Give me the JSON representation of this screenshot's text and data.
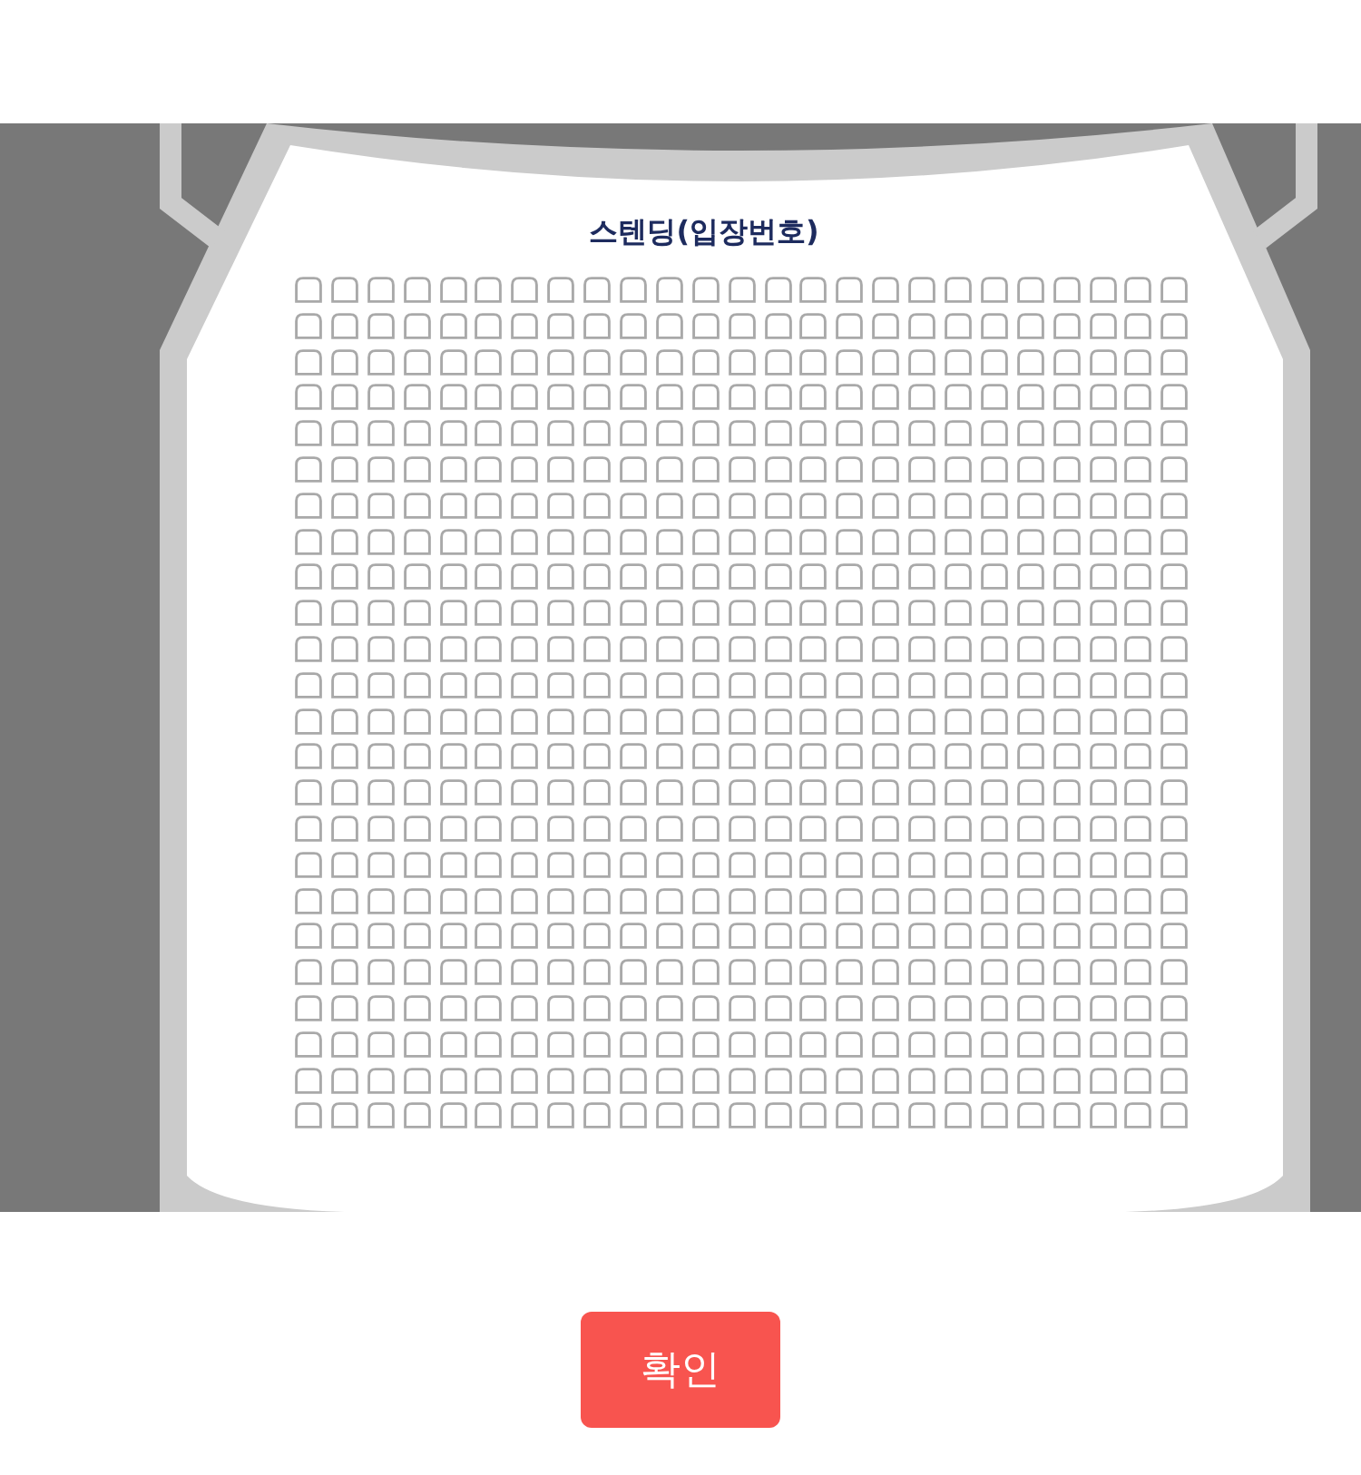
{
  "seat_map": {
    "title": "스텐딩(입장번호)",
    "rows": [
      {
        "seats": [
          {
            "selected": false
          },
          {
            "selected": false
          },
          {
            "selected": false
          },
          {
            "selected": false
          },
          {
            "selected": false
          },
          {
            "selected": false
          },
          {
            "selected": false
          },
          {
            "selected": false
          },
          {
            "selected": false
          },
          {
            "selected": false
          },
          {
            "selected": false
          },
          {
            "selected": false
          },
          {
            "selected": false
          },
          {
            "selected": false
          },
          {
            "selected": false
          },
          {
            "selected": false
          },
          {
            "selected": false
          },
          {
            "selected": false
          },
          {
            "selected": false
          },
          {
            "selected": false
          },
          {
            "selected": false
          },
          {
            "selected": false
          },
          {
            "selected": false
          },
          {
            "selected": false
          },
          {
            "selected": false
          }
        ]
      },
      {
        "seats": [
          {
            "selected": false
          },
          {
            "selected": false
          },
          {
            "selected": false
          },
          {
            "selected": false
          },
          {
            "selected": false
          },
          {
            "selected": false
          },
          {
            "selected": false
          },
          {
            "selected": false
          },
          {
            "selected": false
          },
          {
            "selected": false
          },
          {
            "selected": false
          },
          {
            "selected": false
          },
          {
            "selected": false
          },
          {
            "selected": false
          },
          {
            "selected": false
          },
          {
            "selected": false
          },
          {
            "selected": false
          },
          {
            "selected": false
          },
          {
            "selected": false
          },
          {
            "selected": false
          },
          {
            "selected": false
          },
          {
            "selected": false
          },
          {
            "selected": false
          },
          {
            "selected": false
          },
          {
            "selected": false
          }
        ]
      },
      {
        "seats": [
          {
            "selected": false
          },
          {
            "selected": false
          },
          {
            "selected": false
          },
          {
            "selected": false
          },
          {
            "selected": false
          },
          {
            "selected": false
          },
          {
            "selected": false
          },
          {
            "selected": false
          },
          {
            "selected": false
          },
          {
            "selected": false
          },
          {
            "selected": false
          },
          {
            "selected": false
          },
          {
            "selected": false
          },
          {
            "selected": false
          },
          {
            "selected": false
          },
          {
            "selected": false
          },
          {
            "selected": false
          },
          {
            "selected": false
          },
          {
            "selected": false
          },
          {
            "selected": false
          },
          {
            "selected": false
          },
          {
            "selected": false
          },
          {
            "selected": false
          },
          {
            "selected": false
          },
          {
            "selected": false
          }
        ]
      },
      {
        "seats": [
          {
            "selected": false
          },
          {
            "selected": false
          },
          {
            "selected": false
          },
          {
            "selected": false
          },
          {
            "selected": false
          },
          {
            "selected": false
          },
          {
            "selected": false
          },
          {
            "selected": false
          },
          {
            "selected": false
          },
          {
            "selected": false
          },
          {
            "selected": false
          },
          {
            "selected": false
          },
          {
            "selected": false
          },
          {
            "selected": false
          },
          {
            "selected": false
          },
          {
            "selected": false
          },
          {
            "selected": false
          },
          {
            "selected": false
          },
          {
            "selected": false
          },
          {
            "selected": false
          },
          {
            "selected": false
          },
          {
            "selected": false
          },
          {
            "selected": false
          },
          {
            "selected": false
          },
          {
            "selected": false
          }
        ]
      },
      {
        "seats": [
          {
            "selected": false
          },
          {
            "selected": false
          },
          {
            "selected": false
          },
          {
            "selected": false
          },
          {
            "selected": false
          },
          {
            "selected": false
          },
          {
            "selected": false
          },
          {
            "selected": false
          },
          {
            "selected": false
          },
          {
            "selected": false
          },
          {
            "selected": false
          },
          {
            "selected": false
          },
          {
            "selected": false
          },
          {
            "selected": false
          },
          {
            "selected": false
          },
          {
            "selected": false
          },
          {
            "selected": false
          },
          {
            "selected": false
          },
          {
            "selected": false
          },
          {
            "selected": false
          },
          {
            "selected": false
          },
          {
            "selected": false
          },
          {
            "selected": false
          },
          {
            "selected": false
          },
          {
            "selected": false
          }
        ]
      },
      {
        "seats": [
          {
            "selected": false
          },
          {
            "selected": false
          },
          {
            "selected": false
          },
          {
            "selected": false
          },
          {
            "selected": false
          },
          {
            "selected": false
          },
          {
            "selected": false
          },
          {
            "selected": false
          },
          {
            "selected": false
          },
          {
            "selected": false
          },
          {
            "selected": false
          },
          {
            "selected": false
          },
          {
            "selected": false
          },
          {
            "selected": false
          },
          {
            "selected": false
          },
          {
            "selected": false
          },
          {
            "selected": false
          },
          {
            "selected": false
          },
          {
            "selected": false
          },
          {
            "selected": false
          },
          {
            "selected": false
          },
          {
            "selected": false
          },
          {
            "selected": false
          },
          {
            "selected": false
          },
          {
            "selected": false
          }
        ]
      },
      {
        "seats": [
          {
            "selected": false
          },
          {
            "selected": false
          },
          {
            "selected": false
          },
          {
            "selected": false
          },
          {
            "selected": false
          },
          {
            "selected": false
          },
          {
            "selected": false
          },
          {
            "selected": false
          },
          {
            "selected": false
          },
          {
            "selected": false
          },
          {
            "selected": false
          },
          {
            "selected": false
          },
          {
            "selected": false
          },
          {
            "selected": false
          },
          {
            "selected": false
          },
          {
            "selected": false
          },
          {
            "selected": false
          },
          {
            "selected": false
          },
          {
            "selected": false
          },
          {
            "selected": false
          },
          {
            "selected": false
          },
          {
            "selected": false
          },
          {
            "selected": false
          },
          {
            "selected": false
          },
          {
            "selected": false
          }
        ]
      },
      {
        "seats": [
          {
            "selected": false
          },
          {
            "selected": false
          },
          {
            "selected": false
          },
          {
            "selected": false
          },
          {
            "selected": false
          },
          {
            "selected": false
          },
          {
            "selected": false
          },
          {
            "selected": false
          },
          {
            "selected": false
          },
          {
            "selected": false
          },
          {
            "selected": false
          },
          {
            "selected": false
          },
          {
            "selected": false
          },
          {
            "selected": false
          },
          {
            "selected": false
          },
          {
            "selected": false
          },
          {
            "selected": false
          },
          {
            "selected": false
          },
          {
            "selected": false
          },
          {
            "selected": false
          },
          {
            "selected": false
          },
          {
            "selected": false
          },
          {
            "selected": false
          },
          {
            "selected": false
          },
          {
            "selected": false
          }
        ]
      },
      {
        "seats": [
          {
            "selected": false
          },
          {
            "selected": false
          },
          {
            "selected": false
          },
          {
            "selected": false
          },
          {
            "selected": false
          },
          {
            "selected": false
          },
          {
            "selected": false
          },
          {
            "selected": false
          },
          {
            "selected": false
          },
          {
            "selected": false
          },
          {
            "selected": false
          },
          {
            "selected": false
          },
          {
            "selected": false
          },
          {
            "selected": false
          },
          {
            "selected": false
          },
          {
            "selected": false
          },
          {
            "selected": false
          },
          {
            "selected": false
          },
          {
            "selected": false
          },
          {
            "selected": false
          },
          {
            "selected": false
          },
          {
            "selected": false
          },
          {
            "selected": false
          },
          {
            "selected": false
          },
          {
            "selected": false
          }
        ]
      },
      {
        "seats": [
          {
            "selected": false
          },
          {
            "selected": false
          },
          {
            "selected": false
          },
          {
            "selected": false
          },
          {
            "selected": false
          },
          {
            "selected": false
          },
          {
            "selected": false
          },
          {
            "selected": false
          },
          {
            "selected": false
          },
          {
            "selected": false
          },
          {
            "selected": false
          },
          {
            "selected": false
          },
          {
            "selected": false
          },
          {
            "selected": false
          },
          {
            "selected": false
          },
          {
            "selected": false
          },
          {
            "selected": false
          },
          {
            "selected": false
          },
          {
            "selected": false
          },
          {
            "selected": false
          },
          {
            "selected": false
          },
          {
            "selected": false
          },
          {
            "selected": false
          },
          {
            "selected": false
          },
          {
            "selected": false
          }
        ]
      },
      {
        "seats": [
          {
            "selected": false
          },
          {
            "selected": false
          },
          {
            "selected": false
          },
          {
            "selected": false
          },
          {
            "selected": false
          },
          {
            "selected": false
          },
          {
            "selected": false
          },
          {
            "selected": false
          },
          {
            "selected": false
          },
          {
            "selected": false
          },
          {
            "selected": false
          },
          {
            "selected": false
          },
          {
            "selected": false
          },
          {
            "selected": false
          },
          {
            "selected": false
          },
          {
            "selected": false
          },
          {
            "selected": false
          },
          {
            "selected": false
          },
          {
            "selected": false
          },
          {
            "selected": false
          },
          {
            "selected": false
          },
          {
            "selected": false
          },
          {
            "selected": false
          },
          {
            "selected": false
          },
          {
            "selected": false
          }
        ]
      },
      {
        "seats": [
          {
            "selected": false
          },
          {
            "selected": false
          },
          {
            "selected": false
          },
          {
            "selected": false
          },
          {
            "selected": false
          },
          {
            "selected": false
          },
          {
            "selected": false
          },
          {
            "selected": false
          },
          {
            "selected": false
          },
          {
            "selected": false
          },
          {
            "selected": false
          },
          {
            "selected": false
          },
          {
            "selected": false
          },
          {
            "selected": false
          },
          {
            "selected": false
          },
          {
            "selected": false
          },
          {
            "selected": false
          },
          {
            "selected": false
          },
          {
            "selected": false
          },
          {
            "selected": false
          },
          {
            "selected": false
          },
          {
            "selected": false
          },
          {
            "selected": false
          },
          {
            "selected": false
          },
          {
            "selected": false
          }
        ]
      },
      {
        "seats": [
          {
            "selected": false
          },
          {
            "selected": false
          },
          {
            "selected": false
          },
          {
            "selected": false
          },
          {
            "selected": false
          },
          {
            "selected": false
          },
          {
            "selected": false
          },
          {
            "selected": false
          },
          {
            "selected": false
          },
          {
            "selected": false
          },
          {
            "selected": false
          },
          {
            "selected": false
          },
          {
            "selected": false
          },
          {
            "selected": false
          },
          {
            "selected": false
          },
          {
            "selected": false
          },
          {
            "selected": false
          },
          {
            "selected": false
          },
          {
            "selected": false
          },
          {
            "selected": false
          },
          {
            "selected": false
          },
          {
            "selected": false
          },
          {
            "selected": false
          },
          {
            "selected": false
          },
          {
            "selected": false
          }
        ]
      },
      {
        "seats": [
          {
            "selected": false
          },
          {
            "selected": false
          },
          {
            "selected": false
          },
          {
            "selected": false
          },
          {
            "selected": false
          },
          {
            "selected": false
          },
          {
            "selected": false
          },
          {
            "selected": false
          },
          {
            "selected": false
          },
          {
            "selected": false
          },
          {
            "selected": false
          },
          {
            "selected": false
          },
          {
            "selected": false
          },
          {
            "selected": false
          },
          {
            "selected": false
          },
          {
            "selected": false
          },
          {
            "selected": false
          },
          {
            "selected": false
          },
          {
            "selected": false
          },
          {
            "selected": false
          },
          {
            "selected": false
          },
          {
            "selected": false
          },
          {
            "selected": false
          },
          {
            "selected": false
          },
          {
            "selected": false
          }
        ]
      },
      {
        "seats": [
          {
            "selected": false
          },
          {
            "selected": false
          },
          {
            "selected": false
          },
          {
            "selected": false
          },
          {
            "selected": false
          },
          {
            "selected": false
          },
          {
            "selected": false
          },
          {
            "selected": false
          },
          {
            "selected": false
          },
          {
            "selected": false
          },
          {
            "selected": false
          },
          {
            "selected": false
          },
          {
            "selected": false
          },
          {
            "selected": false
          },
          {
            "selected": false
          },
          {
            "selected": false
          },
          {
            "selected": false
          },
          {
            "selected": false
          },
          {
            "selected": false
          },
          {
            "selected": false
          },
          {
            "selected": false
          },
          {
            "selected": false
          },
          {
            "selected": false
          },
          {
            "selected": false
          },
          {
            "selected": false
          }
        ]
      },
      {
        "seats": [
          {
            "selected": false
          },
          {
            "selected": false
          },
          {
            "selected": false
          },
          {
            "selected": false
          },
          {
            "selected": false
          },
          {
            "selected": false
          },
          {
            "selected": false
          },
          {
            "selected": false
          },
          {
            "selected": false
          },
          {
            "selected": false
          },
          {
            "selected": false
          },
          {
            "selected": false
          },
          {
            "selected": false
          },
          {
            "selected": false
          },
          {
            "selected": false
          },
          {
            "selected": false
          },
          {
            "selected": false
          },
          {
            "selected": false
          },
          {
            "selected": false
          },
          {
            "selected": false
          },
          {
            "selected": false
          },
          {
            "selected": false
          },
          {
            "selected": false
          },
          {
            "selected": false
          },
          {
            "selected": false
          }
        ]
      },
      {
        "seats": [
          {
            "selected": false
          },
          {
            "selected": false
          },
          {
            "selected": false
          },
          {
            "selected": false
          },
          {
            "selected": false
          },
          {
            "selected": false
          },
          {
            "selected": false
          },
          {
            "selected": false
          },
          {
            "selected": false
          },
          {
            "selected": false
          },
          {
            "selected": false
          },
          {
            "selected": false
          },
          {
            "selected": false
          },
          {
            "selected": false
          },
          {
            "selected": false
          },
          {
            "selected": false
          },
          {
            "selected": false
          },
          {
            "selected": false
          },
          {
            "selected": false
          },
          {
            "selected": false
          },
          {
            "selected": false
          },
          {
            "selected": false
          },
          {
            "selected": false
          },
          {
            "selected": false
          },
          {
            "selected": false
          }
        ]
      },
      {
        "seats": [
          {
            "selected": false
          },
          {
            "selected": false
          },
          {
            "selected": false
          },
          {
            "selected": false
          },
          {
            "selected": false
          },
          {
            "selected": false
          },
          {
            "selected": false
          },
          {
            "selected": false
          },
          {
            "selected": false
          },
          {
            "selected": false
          },
          {
            "selected": false
          },
          {
            "selected": false
          },
          {
            "selected": false
          },
          {
            "selected": false
          },
          {
            "selected": false
          },
          {
            "selected": false
          },
          {
            "selected": false
          },
          {
            "selected": false
          },
          {
            "selected": false
          },
          {
            "selected": false
          },
          {
            "selected": false
          },
          {
            "selected": false
          },
          {
            "selected": false
          },
          {
            "selected": false
          },
          {
            "selected": false
          }
        ]
      },
      {
        "seats": [
          {
            "selected": false
          },
          {
            "selected": false
          },
          {
            "selected": false
          },
          {
            "selected": false
          },
          {
            "selected": false
          },
          {
            "selected": false
          },
          {
            "selected": false
          },
          {
            "selected": false
          },
          {
            "selected": false
          },
          {
            "selected": false
          },
          {
            "selected": false
          },
          {
            "selected": false
          },
          {
            "selected": false
          },
          {
            "selected": false
          },
          {
            "selected": false
          },
          {
            "selected": false
          },
          {
            "selected": false
          },
          {
            "selected": false
          },
          {
            "selected": false
          },
          {
            "selected": false
          },
          {
            "selected": false
          },
          {
            "selected": false
          },
          {
            "selected": false
          },
          {
            "selected": false
          },
          {
            "selected": false
          }
        ]
      },
      {
        "seats": [
          {
            "selected": false
          },
          {
            "selected": false
          },
          {
            "selected": false
          },
          {
            "selected": false
          },
          {
            "selected": false
          },
          {
            "selected": false
          },
          {
            "selected": false
          },
          {
            "selected": false
          },
          {
            "selected": false
          },
          {
            "selected": false
          },
          {
            "selected": false
          },
          {
            "selected": false
          },
          {
            "selected": false
          },
          {
            "selected": false
          },
          {
            "selected": false
          },
          {
            "selected": false
          },
          {
            "selected": false
          },
          {
            "selected": false
          },
          {
            "selected": false
          },
          {
            "selected": false
          },
          {
            "selected": false
          },
          {
            "selected": false
          },
          {
            "selected": false
          },
          {
            "selected": false
          },
          {
            "selected": false
          }
        ]
      },
      {
        "seats": [
          {
            "selected": false
          },
          {
            "selected": false
          },
          {
            "selected": false
          },
          {
            "selected": false
          },
          {
            "selected": false
          },
          {
            "selected": false
          },
          {
            "selected": false
          },
          {
            "selected": false
          },
          {
            "selected": false
          },
          {
            "selected": false
          },
          {
            "selected": false
          },
          {
            "selected": false
          },
          {
            "selected": false
          },
          {
            "selected": false
          },
          {
            "selected": false
          },
          {
            "selected": false
          },
          {
            "selected": false
          },
          {
            "selected": false
          },
          {
            "selected": false
          },
          {
            "selected": false
          },
          {
            "selected": false
          },
          {
            "selected": false
          },
          {
            "selected": false
          },
          {
            "selected": false
          },
          {
            "selected": false
          }
        ]
      },
      {
        "seats": [
          {
            "selected": false
          },
          {
            "selected": false
          },
          {
            "selected": false
          },
          {
            "selected": false
          },
          {
            "selected": false
          },
          {
            "selected": false
          },
          {
            "selected": false
          },
          {
            "selected": false
          },
          {
            "selected": false
          },
          {
            "selected": false
          },
          {
            "selected": false
          },
          {
            "selected": false
          },
          {
            "selected": false
          },
          {
            "selected": false
          },
          {
            "selected": false
          },
          {
            "selected": false
          },
          {
            "selected": false
          },
          {
            "selected": false
          },
          {
            "selected": false
          },
          {
            "selected": false
          },
          {
            "selected": false
          },
          {
            "selected": false
          },
          {
            "selected": false
          },
          {
            "selected": false
          },
          {
            "selected": false
          }
        ]
      },
      {
        "seats": [
          {
            "selected": false
          },
          {
            "selected": false
          },
          {
            "selected": false
          },
          {
            "selected": false
          },
          {
            "selected": false
          },
          {
            "selected": false
          },
          {
            "selected": false
          },
          {
            "selected": false
          },
          {
            "selected": false
          },
          {
            "selected": false
          },
          {
            "selected": false
          },
          {
            "selected": false
          },
          {
            "selected": false
          },
          {
            "selected": false
          },
          {
            "selected": false
          },
          {
            "selected": false
          },
          {
            "selected": false
          },
          {
            "selected": false
          },
          {
            "selected": false
          },
          {
            "selected": false
          },
          {
            "selected": false
          },
          {
            "selected": false
          },
          {
            "selected": false
          },
          {
            "selected": false
          },
          {
            "selected": false
          }
        ]
      },
      {
        "seats": [
          {
            "selected": false
          },
          {
            "selected": false
          },
          {
            "selected": false
          },
          {
            "selected": false
          },
          {
            "selected": false
          },
          {
            "selected": false
          },
          {
            "selected": false
          },
          {
            "selected": false
          },
          {
            "selected": false
          },
          {
            "selected": false
          },
          {
            "selected": false
          },
          {
            "selected": false
          },
          {
            "selected": false
          },
          {
            "selected": false
          },
          {
            "selected": false
          },
          {
            "selected": false
          },
          {
            "selected": false
          },
          {
            "selected": false
          },
          {
            "selected": false
          },
          {
            "selected": false
          },
          {
            "selected": false
          },
          {
            "selected": false
          },
          {
            "selected": false
          },
          {
            "selected": false
          },
          {
            "selected": false
          }
        ]
      }
    ]
  },
  "confirm_button": {
    "label": "확인"
  }
}
